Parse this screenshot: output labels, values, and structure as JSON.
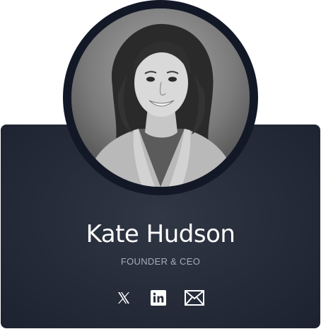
{
  "profile": {
    "name": "Kate Hudson",
    "role": "FOUNDER & CEO",
    "photo_icon": "profile-photo"
  },
  "socials": [
    {
      "icon": "x-icon"
    },
    {
      "icon": "linkedin-icon"
    },
    {
      "icon": "mail-icon"
    }
  ],
  "colors": {
    "card_background": "#272d3a",
    "avatar_ring": "#121826",
    "name_text": "#ffffff",
    "role_text": "#a6acb8",
    "icon_color": "#ffffff"
  }
}
